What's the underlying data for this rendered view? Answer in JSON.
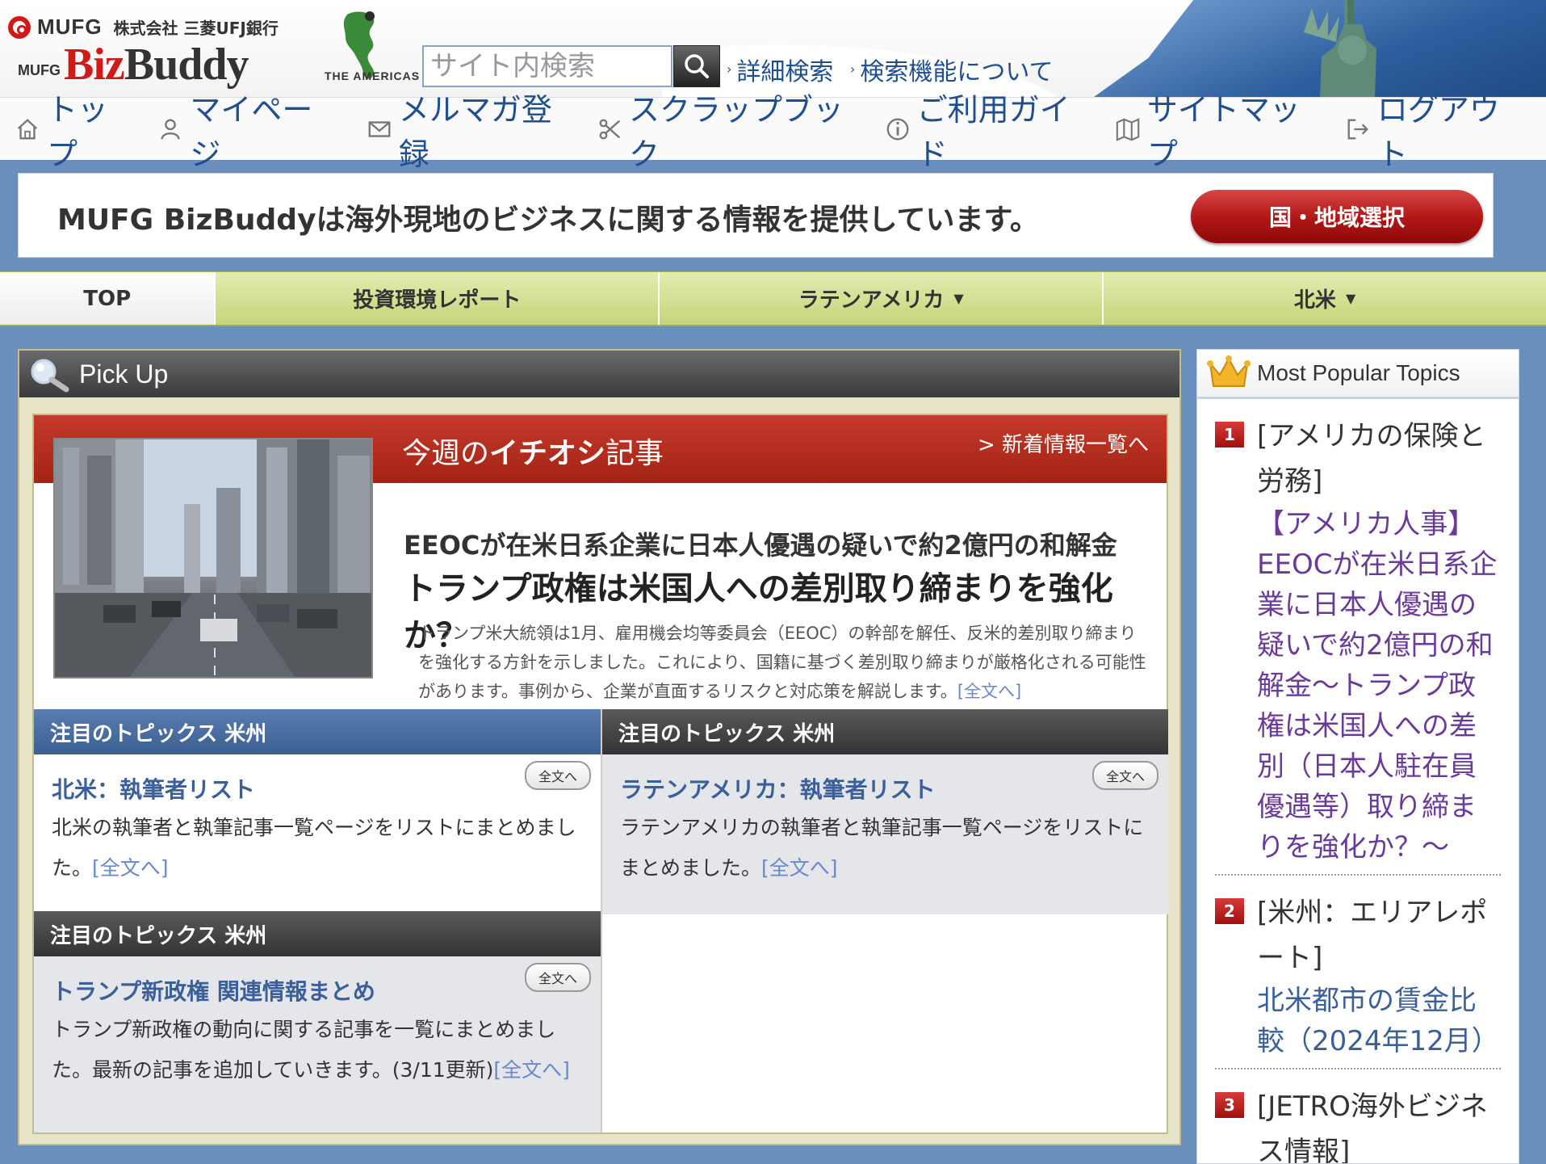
{
  "header": {
    "bank_brand": "MUFG",
    "bank_name": "株式会社 三菱UFJ銀行",
    "product_prefix": "MUFG",
    "product_biz": "Biz",
    "product_buddy": "Buddy",
    "region_label": "THE AMERICAS",
    "search_placeholder": "サイト内検索",
    "advanced_search": "詳細検索",
    "search_help": "検索機能について"
  },
  "nav": {
    "items": [
      {
        "label": "トップ",
        "icon": "home-icon"
      },
      {
        "label": "マイページ",
        "icon": "user-icon"
      },
      {
        "label": "メルマガ登録",
        "icon": "mail-icon"
      },
      {
        "label": "スクラップブック",
        "icon": "scissors-icon"
      },
      {
        "label": "ご利用ガイド",
        "icon": "info-icon"
      },
      {
        "label": "サイトマップ",
        "icon": "map-icon"
      },
      {
        "label": "ログアウト",
        "icon": "logout-icon"
      }
    ]
  },
  "banner": {
    "text": "MUFG BizBuddyは海外現地のビジネスに関する情報を提供しています。",
    "region_button": "国・地域選択"
  },
  "tabs": [
    {
      "label": "TOP",
      "active": true,
      "dropdown": false
    },
    {
      "label": "投資環境レポート",
      "active": false,
      "dropdown": false
    },
    {
      "label": "ラテンアメリカ",
      "active": false,
      "dropdown": true
    },
    {
      "label": "北米",
      "active": false,
      "dropdown": true
    }
  ],
  "pickup": {
    "title": "Pick Up",
    "feature": {
      "label_pre": "今週の",
      "label_bold": "イチオシ",
      "label_post": "記事",
      "newlist_link": "> 新着情報一覧へ",
      "headline1": "EEOCが在米日系企業に日本人優遇の疑いで約2億円の和解金",
      "headline2": "トランプ政権は米国人への差別取り締まりを強化か？",
      "body": "トランプ米大統領は1月、雇用機会均等委員会（EEOC）の幹部を解任、反米的差別取り締まりを強化する方針を示しました。これにより、国籍に基づく差別取り締まりが厳格化される可能性があります。事例から、企業が直面するリスクと対応策を解説します。",
      "body_link": "[全文へ]"
    },
    "topics": [
      {
        "header": "注目のトピックス 米州",
        "title": "北米：執筆者リスト",
        "text": "北米の執筆者と執筆記事一覧ページをリストにまとめました。",
        "link": "[全文へ]",
        "button": "全文へ"
      },
      {
        "header": "注目のトピックス 米州",
        "title": "ラテンアメリカ：執筆者リスト",
        "text": "ラテンアメリカの執筆者と執筆記事一覧ページをリストにまとめました。",
        "link": "[全文へ]",
        "button": "全文へ"
      },
      {
        "header": "注目のトピックス 米州",
        "title": "トランプ新政権 関連情報まとめ",
        "text": "トランプ新政権の動向に関する記事を一覧にまとめました。最新の記事を追加していきます。(3/11更新)",
        "link": "[全文へ]",
        "button": "全文へ"
      }
    ]
  },
  "popular": {
    "title": "Most Popular Topics",
    "items": [
      {
        "rank": "1",
        "category": "[アメリカの保険と労務]",
        "title": "【アメリカ人事】EEOCが在米日系企業に日本人優遇の疑いで約2億円の和解金〜トランプ政権は米国人への差別（日本人駐在員優遇等）取り締まりを強化か？〜"
      },
      {
        "rank": "2",
        "category": "[米州：エリアレポート]",
        "title": "北米都市の賃金比較（2024年12月）"
      },
      {
        "rank": "3",
        "category": "[JETRO海外ビジネス情報]",
        "title": ""
      }
    ]
  },
  "colors": {
    "brand_red": "#d01a1a",
    "link_blue": "#1f4f8f",
    "visited_purple": "#6a3a9a",
    "tab_green": "#c5d57a",
    "page_bg": "#6b8fbd"
  }
}
